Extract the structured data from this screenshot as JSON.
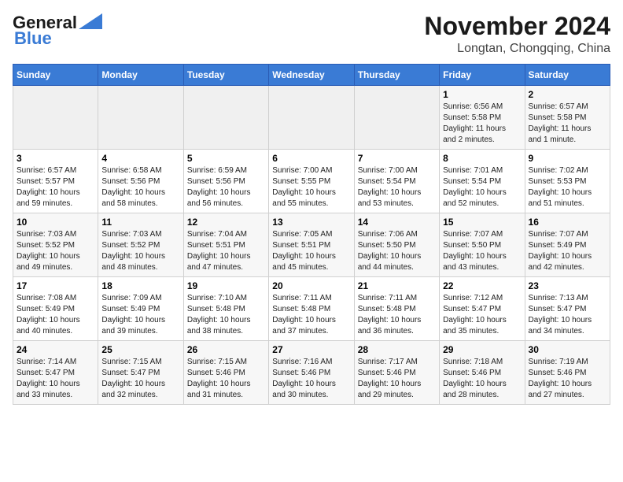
{
  "header": {
    "logo_line1": "General",
    "logo_line2": "Blue",
    "month": "November 2024",
    "location": "Longtan, Chongqing, China"
  },
  "weekdays": [
    "Sunday",
    "Monday",
    "Tuesday",
    "Wednesday",
    "Thursday",
    "Friday",
    "Saturday"
  ],
  "weeks": [
    [
      {
        "day": "",
        "info": ""
      },
      {
        "day": "",
        "info": ""
      },
      {
        "day": "",
        "info": ""
      },
      {
        "day": "",
        "info": ""
      },
      {
        "day": "",
        "info": ""
      },
      {
        "day": "1",
        "info": "Sunrise: 6:56 AM\nSunset: 5:58 PM\nDaylight: 11 hours\nand 2 minutes."
      },
      {
        "day": "2",
        "info": "Sunrise: 6:57 AM\nSunset: 5:58 PM\nDaylight: 11 hours\nand 1 minute."
      }
    ],
    [
      {
        "day": "3",
        "info": "Sunrise: 6:57 AM\nSunset: 5:57 PM\nDaylight: 10 hours\nand 59 minutes."
      },
      {
        "day": "4",
        "info": "Sunrise: 6:58 AM\nSunset: 5:56 PM\nDaylight: 10 hours\nand 58 minutes."
      },
      {
        "day": "5",
        "info": "Sunrise: 6:59 AM\nSunset: 5:56 PM\nDaylight: 10 hours\nand 56 minutes."
      },
      {
        "day": "6",
        "info": "Sunrise: 7:00 AM\nSunset: 5:55 PM\nDaylight: 10 hours\nand 55 minutes."
      },
      {
        "day": "7",
        "info": "Sunrise: 7:00 AM\nSunset: 5:54 PM\nDaylight: 10 hours\nand 53 minutes."
      },
      {
        "day": "8",
        "info": "Sunrise: 7:01 AM\nSunset: 5:54 PM\nDaylight: 10 hours\nand 52 minutes."
      },
      {
        "day": "9",
        "info": "Sunrise: 7:02 AM\nSunset: 5:53 PM\nDaylight: 10 hours\nand 51 minutes."
      }
    ],
    [
      {
        "day": "10",
        "info": "Sunrise: 7:03 AM\nSunset: 5:52 PM\nDaylight: 10 hours\nand 49 minutes."
      },
      {
        "day": "11",
        "info": "Sunrise: 7:03 AM\nSunset: 5:52 PM\nDaylight: 10 hours\nand 48 minutes."
      },
      {
        "day": "12",
        "info": "Sunrise: 7:04 AM\nSunset: 5:51 PM\nDaylight: 10 hours\nand 47 minutes."
      },
      {
        "day": "13",
        "info": "Sunrise: 7:05 AM\nSunset: 5:51 PM\nDaylight: 10 hours\nand 45 minutes."
      },
      {
        "day": "14",
        "info": "Sunrise: 7:06 AM\nSunset: 5:50 PM\nDaylight: 10 hours\nand 44 minutes."
      },
      {
        "day": "15",
        "info": "Sunrise: 7:07 AM\nSunset: 5:50 PM\nDaylight: 10 hours\nand 43 minutes."
      },
      {
        "day": "16",
        "info": "Sunrise: 7:07 AM\nSunset: 5:49 PM\nDaylight: 10 hours\nand 42 minutes."
      }
    ],
    [
      {
        "day": "17",
        "info": "Sunrise: 7:08 AM\nSunset: 5:49 PM\nDaylight: 10 hours\nand 40 minutes."
      },
      {
        "day": "18",
        "info": "Sunrise: 7:09 AM\nSunset: 5:49 PM\nDaylight: 10 hours\nand 39 minutes."
      },
      {
        "day": "19",
        "info": "Sunrise: 7:10 AM\nSunset: 5:48 PM\nDaylight: 10 hours\nand 38 minutes."
      },
      {
        "day": "20",
        "info": "Sunrise: 7:11 AM\nSunset: 5:48 PM\nDaylight: 10 hours\nand 37 minutes."
      },
      {
        "day": "21",
        "info": "Sunrise: 7:11 AM\nSunset: 5:48 PM\nDaylight: 10 hours\nand 36 minutes."
      },
      {
        "day": "22",
        "info": "Sunrise: 7:12 AM\nSunset: 5:47 PM\nDaylight: 10 hours\nand 35 minutes."
      },
      {
        "day": "23",
        "info": "Sunrise: 7:13 AM\nSunset: 5:47 PM\nDaylight: 10 hours\nand 34 minutes."
      }
    ],
    [
      {
        "day": "24",
        "info": "Sunrise: 7:14 AM\nSunset: 5:47 PM\nDaylight: 10 hours\nand 33 minutes."
      },
      {
        "day": "25",
        "info": "Sunrise: 7:15 AM\nSunset: 5:47 PM\nDaylight: 10 hours\nand 32 minutes."
      },
      {
        "day": "26",
        "info": "Sunrise: 7:15 AM\nSunset: 5:46 PM\nDaylight: 10 hours\nand 31 minutes."
      },
      {
        "day": "27",
        "info": "Sunrise: 7:16 AM\nSunset: 5:46 PM\nDaylight: 10 hours\nand 30 minutes."
      },
      {
        "day": "28",
        "info": "Sunrise: 7:17 AM\nSunset: 5:46 PM\nDaylight: 10 hours\nand 29 minutes."
      },
      {
        "day": "29",
        "info": "Sunrise: 7:18 AM\nSunset: 5:46 PM\nDaylight: 10 hours\nand 28 minutes."
      },
      {
        "day": "30",
        "info": "Sunrise: 7:19 AM\nSunset: 5:46 PM\nDaylight: 10 hours\nand 27 minutes."
      }
    ]
  ]
}
